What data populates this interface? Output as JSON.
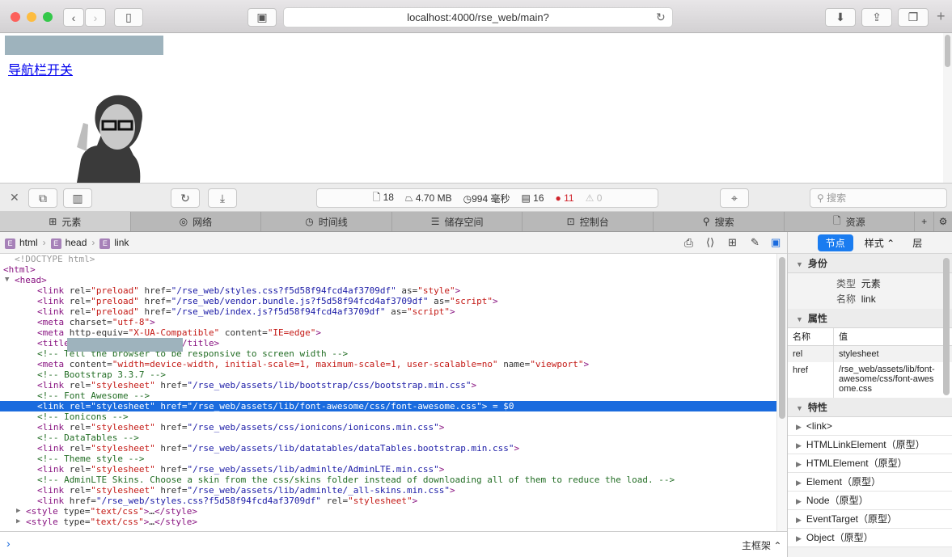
{
  "browser": {
    "url": "localhost:4000/rse_web/main?",
    "colors": {
      "close": "#fc605b",
      "min": "#fdbc40",
      "max": "#34c84a"
    }
  },
  "page": {
    "nav_toggle_link": "导航栏开关"
  },
  "devtools": {
    "stats": {
      "resources": "18",
      "size": "4.70 MB",
      "time": "994 毫秒",
      "logs": "16",
      "errors": "11",
      "warnings": "0"
    },
    "search_placeholder": "搜索",
    "tabs": [
      "元素",
      "网络",
      "时间线",
      "储存空间",
      "控制台",
      "搜索",
      "资源"
    ],
    "breadcrumb": [
      "html",
      "head",
      "link"
    ],
    "dom_lines": [
      {
        "i": 1,
        "t": [
          [
            "dt",
            "<!DOCTYPE html>"
          ]
        ]
      },
      {
        "i": 0,
        "a": "▼",
        "t": [
          [
            "tg",
            "<html>"
          ]
        ]
      },
      {
        "i": 1,
        "a": "▼",
        "t": [
          [
            "tg",
            "<head>"
          ]
        ]
      },
      {
        "i": 3,
        "t": [
          [
            "tg",
            "<link "
          ],
          [
            "an",
            "rel="
          ],
          [
            "ar",
            "\"preload\" "
          ],
          [
            "an",
            "href="
          ],
          [
            "av",
            "\"/rse_web/styles.css?f5d58f94fcd4af3709df\" "
          ],
          [
            "an",
            "as="
          ],
          [
            "ar",
            "\"style\""
          ],
          [
            "tg",
            ">"
          ]
        ]
      },
      {
        "i": 3,
        "t": [
          [
            "tg",
            "<link "
          ],
          [
            "an",
            "rel="
          ],
          [
            "ar",
            "\"preload\" "
          ],
          [
            "an",
            "href="
          ],
          [
            "av",
            "\"/rse_web/vendor.bundle.js?f5d58f94fcd4af3709df\" "
          ],
          [
            "an",
            "as="
          ],
          [
            "ar",
            "\"script\""
          ],
          [
            "tg",
            ">"
          ]
        ]
      },
      {
        "i": 3,
        "t": [
          [
            "tg",
            "<link "
          ],
          [
            "an",
            "rel="
          ],
          [
            "ar",
            "\"preload\" "
          ],
          [
            "an",
            "href="
          ],
          [
            "av",
            "\"/rse_web/index.js?f5d58f94fcd4af3709df\" "
          ],
          [
            "an",
            "as="
          ],
          [
            "ar",
            "\"script\""
          ],
          [
            "tg",
            ">"
          ]
        ]
      },
      {
        "i": 3,
        "t": [
          [
            "tg",
            "<meta "
          ],
          [
            "an",
            "charset="
          ],
          [
            "ar",
            "\"utf-8\""
          ],
          [
            "tg",
            ">"
          ]
        ]
      },
      {
        "i": 3,
        "t": [
          [
            "tg",
            "<meta "
          ],
          [
            "an",
            "http-equiv="
          ],
          [
            "ar",
            "\"X-UA-Compatible\" "
          ],
          [
            "an",
            "content="
          ],
          [
            "ar",
            "\"IE=edge\""
          ],
          [
            "tg",
            ">"
          ]
        ]
      },
      {
        "i": 3,
        "t": [
          [
            "tg",
            "<title"
          ],
          [
            "tx",
            "                    "
          ],
          [
            "tg",
            "</title>"
          ]
        ]
      },
      {
        "i": 3,
        "t": [
          [
            "cm",
            "<!-- Tell the browser to be responsive to screen width -->"
          ]
        ]
      },
      {
        "i": 3,
        "t": [
          [
            "tg",
            "<meta "
          ],
          [
            "an",
            "content="
          ],
          [
            "ar",
            "\"width=device-width, initial-scale=1, maximum-scale=1, user-scalable=no\" "
          ],
          [
            "an",
            "name="
          ],
          [
            "ar",
            "\"viewport\""
          ],
          [
            "tg",
            ">"
          ]
        ]
      },
      {
        "i": 3,
        "t": [
          [
            "cm",
            "<!-- Bootstrap 3.3.7 -->"
          ]
        ]
      },
      {
        "i": 3,
        "t": [
          [
            "tg",
            "<link "
          ],
          [
            "an",
            "rel="
          ],
          [
            "ar",
            "\"stylesheet\" "
          ],
          [
            "an",
            "href="
          ],
          [
            "av",
            "\"/rse_web/assets/lib/bootstrap/css/bootstrap.min.css\""
          ],
          [
            "tg",
            ">"
          ]
        ]
      },
      {
        "i": 3,
        "t": [
          [
            "cm",
            "<!-- Font Awesome -->"
          ]
        ]
      },
      {
        "i": 3,
        "sel": true,
        "t": [
          [
            "tg",
            "<link "
          ],
          [
            "an",
            "rel="
          ],
          [
            "ar",
            "\"stylesheet\" "
          ],
          [
            "an",
            "href="
          ],
          [
            "av",
            "\"/rse_web/assets/lib/font-awesome/css/font-awesome.css\""
          ],
          [
            "tg",
            ">"
          ],
          [
            "tx",
            " = $0"
          ]
        ]
      },
      {
        "i": 3,
        "t": [
          [
            "cm",
            "<!-- Ionicons -->"
          ]
        ]
      },
      {
        "i": 3,
        "t": [
          [
            "tg",
            "<link "
          ],
          [
            "an",
            "rel="
          ],
          [
            "ar",
            "\"stylesheet\" "
          ],
          [
            "an",
            "href="
          ],
          [
            "av",
            "\"/rse_web/assets/css/ionicons/ionicons.min.css\""
          ],
          [
            "tg",
            ">"
          ]
        ]
      },
      {
        "i": 3,
        "t": [
          [
            "cm",
            "<!-- DataTables -->"
          ]
        ]
      },
      {
        "i": 3,
        "t": [
          [
            "tg",
            "<link "
          ],
          [
            "an",
            "rel="
          ],
          [
            "ar",
            "\"stylesheet\" "
          ],
          [
            "an",
            "href="
          ],
          [
            "av",
            "\"/rse_web/assets/lib/datatables/dataTables.bootstrap.min.css\""
          ],
          [
            "tg",
            ">"
          ]
        ]
      },
      {
        "i": 3,
        "t": [
          [
            "cm",
            "<!-- Theme style -->"
          ]
        ]
      },
      {
        "i": 3,
        "t": [
          [
            "tg",
            "<link "
          ],
          [
            "an",
            "rel="
          ],
          [
            "ar",
            "\"stylesheet\" "
          ],
          [
            "an",
            "href="
          ],
          [
            "av",
            "\"/rse_web/assets/lib/adminlte/AdminLTE.min.css\""
          ],
          [
            "tg",
            ">"
          ]
        ]
      },
      {
        "i": 3,
        "t": [
          [
            "cm",
            "<!-- AdminLTE Skins. Choose a skin from the css/skins folder instead of downloading all of them to reduce the load. -->"
          ]
        ]
      },
      {
        "i": 3,
        "t": [
          [
            "tg",
            "<link "
          ],
          [
            "an",
            "rel="
          ],
          [
            "ar",
            "\"stylesheet\" "
          ],
          [
            "an",
            "href="
          ],
          [
            "av",
            "\"/rse_web/assets/lib/adminlte/_all-skins.min.css\""
          ],
          [
            "tg",
            ">"
          ]
        ]
      },
      {
        "i": 3,
        "t": [
          [
            "tg",
            "<link "
          ],
          [
            "an",
            "href="
          ],
          [
            "av",
            "\"/rse_web/styles.css?f5d58f94fcd4af3709df\" "
          ],
          [
            "an",
            "rel="
          ],
          [
            "ar",
            "\"stylesheet\""
          ],
          [
            "tg",
            ">"
          ]
        ]
      },
      {
        "i": 2,
        "a": "▶",
        "t": [
          [
            "tg",
            "<style "
          ],
          [
            "an",
            "type="
          ],
          [
            "ar",
            "\"text/css\""
          ],
          [
            "tg",
            ">"
          ],
          [
            "tx",
            "…"
          ],
          [
            "tg",
            "</style>"
          ]
        ]
      },
      {
        "i": 2,
        "a": "▶",
        "t": [
          [
            "tg",
            "<style "
          ],
          [
            "an",
            "type="
          ],
          [
            "ar",
            "\"text/css\""
          ],
          [
            "tg",
            ">"
          ],
          [
            "tx",
            "…"
          ],
          [
            "tg",
            "</style>"
          ]
        ]
      }
    ],
    "console_frame": "主框架",
    "sidebar": {
      "tabs": [
        "节点",
        "样式",
        "层"
      ],
      "identity": {
        "title": "身份",
        "type_label": "类型",
        "type_value": "元素",
        "name_label": "名称",
        "name_value": "link"
      },
      "attributes": {
        "title": "属性",
        "col_name": "名称",
        "col_value": "值",
        "rows": [
          {
            "name": "rel",
            "value": "stylesheet"
          },
          {
            "name": "href",
            "value": "/rse_web/assets/lib/font-awesome/css/font-awesome.css"
          }
        ]
      },
      "properties": {
        "title": "特性",
        "items": [
          "<link>",
          "HTMLLinkElement（原型）",
          "HTMLElement（原型）",
          "Element（原型）",
          "Node（原型）",
          "EventTarget（原型）",
          "Object（原型）"
        ]
      }
    }
  }
}
